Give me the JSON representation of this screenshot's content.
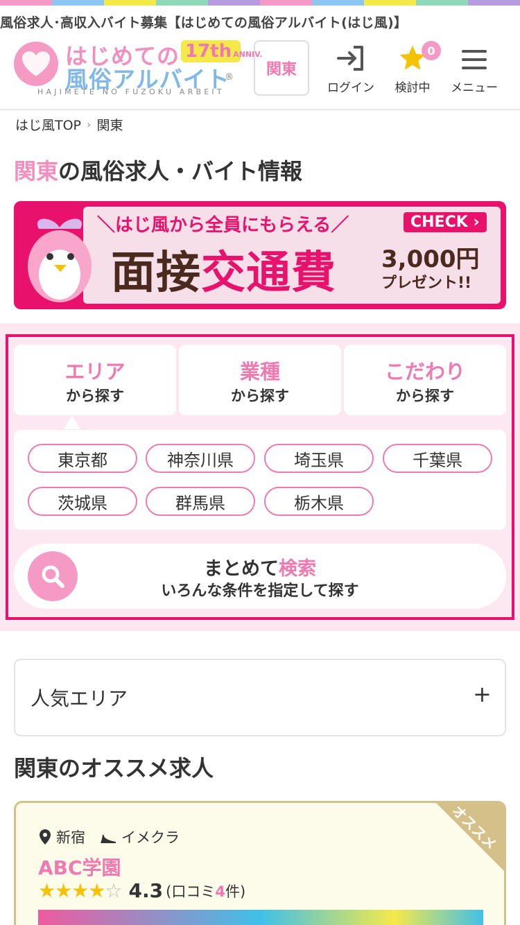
{
  "strip_colors": [
    "#f49ac5",
    "#8bc7f0",
    "#f5e94a",
    "#8fd8b8",
    "#b79ae0",
    "#f49ac5",
    "#8bc7f0",
    "#f5e94a",
    "#8fd8b8",
    "#b79ae0"
  ],
  "seo_title": "風俗求人･高収入バイト募集【はじめての風俗アルバイト(はじ風)】",
  "logo": {
    "line1": "はじめての",
    "line2": "風俗アルバイト",
    "sub": "HAJIMETE NO FUZOKU ARBEIT",
    "anniv_num": "17th",
    "anniv_txt": "ANNIV.",
    "reg": "®"
  },
  "header": {
    "region": "関東",
    "login": "ログイン",
    "favorites": "検討中",
    "favorites_count": "0",
    "menu": "メニュー"
  },
  "breadcrumb": {
    "home": "はじ風TOP",
    "sep": "›",
    "current": "関東"
  },
  "page_title": {
    "accent": "関東",
    "rest": "の風俗求人・バイト情報"
  },
  "banner": {
    "top": "＼はじ風から全員にもらえる／",
    "check": "CHECK ›",
    "main_a": "面接",
    "main_b": "交通費",
    "amount": "3,000円",
    "present": "プレゼント!!"
  },
  "search_tabs": [
    {
      "title": "エリア",
      "sub": "から探す"
    },
    {
      "title": "業種",
      "sub": "から探す"
    },
    {
      "title": "こだわり",
      "sub": "から探す"
    }
  ],
  "prefectures": [
    "東京都",
    "神奈川県",
    "埼玉県",
    "千葉県",
    "茨城県",
    "群馬県",
    "栃木県"
  ],
  "bulk_search": {
    "l1a": "まとめて",
    "l1b": "検索",
    "l2": "いろんな条件を指定して探す"
  },
  "popular_area": {
    "label": "人気エリア",
    "toggle": "+"
  },
  "section_title": "関東のオススメ求人",
  "job": {
    "corner": "オススメ",
    "location": "新宿",
    "category": "イメクラ",
    "name": "ABC学園",
    "stars_full": "★★★★",
    "stars_empty": "☆",
    "rating_value": 4,
    "score": "4.3",
    "reviews_a": "(口コミ",
    "reviews_n": "4",
    "reviews_b": "件)"
  }
}
